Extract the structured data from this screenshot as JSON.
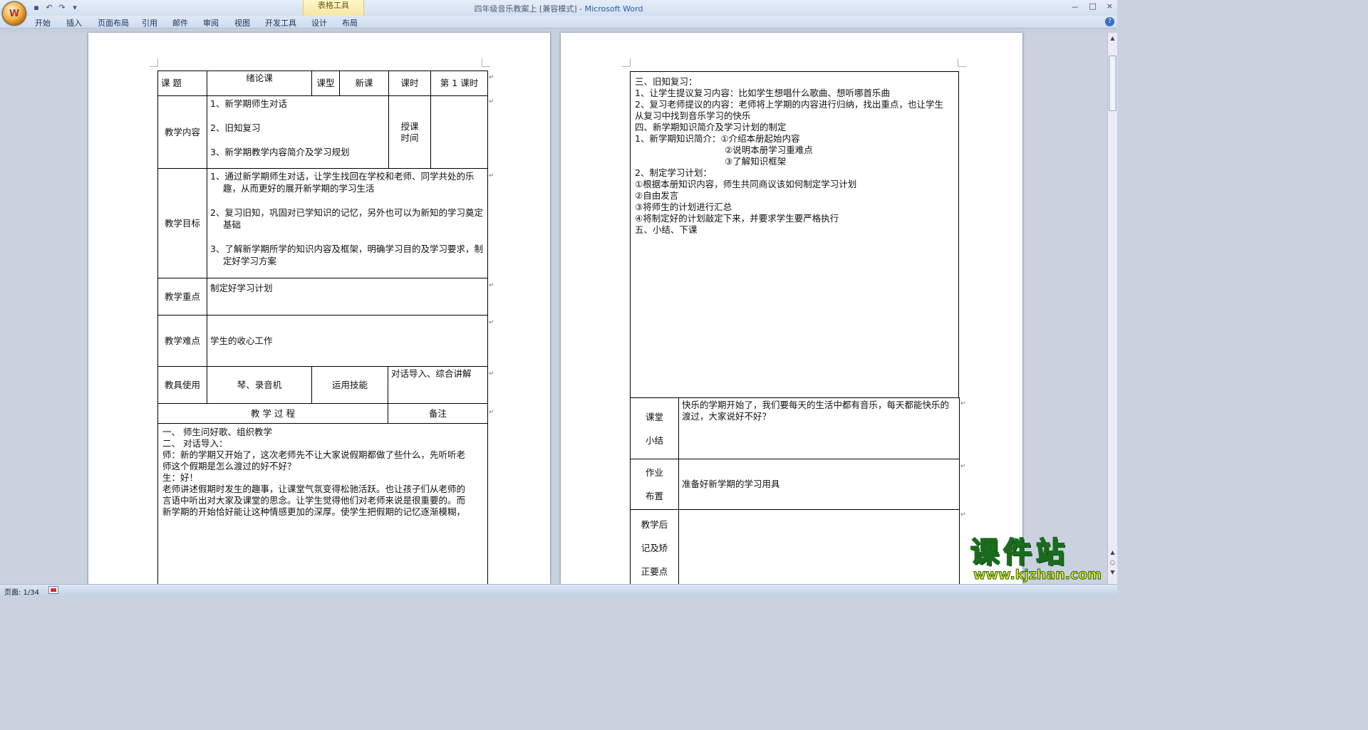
{
  "window": {
    "title_doc": "四年级音乐教案上 [兼容模式]",
    "title_sep": " - ",
    "title_app": "Microsoft Word",
    "context_tab_group": "表格工具",
    "controls": [
      "－",
      "□",
      "×"
    ]
  },
  "office_button": {
    "glyph": "W"
  },
  "qat": [
    "save-icon",
    "undo-icon",
    "redo-icon",
    "customize-icon"
  ],
  "qat_glyphs": [
    "▪",
    "↶",
    "↷",
    "▾"
  ],
  "ribbon_tabs": [
    "开始",
    "插入",
    "页面布局",
    "引用",
    "邮件",
    "审阅",
    "视图",
    "开发工具",
    "设计",
    "布局"
  ],
  "page1": {
    "row1": {
      "c1": "课    题",
      "c2": "绪论课",
      "c3": "课型",
      "c4": "新课",
      "c5": "课时",
      "c6": "第 1 课时"
    },
    "content": {
      "label": "教学内容",
      "items": [
        "1、新学期师生对话",
        "2、旧知复习",
        "3、新学期教学内容简介及学习规划"
      ],
      "time_label": "授课时间"
    },
    "goals": {
      "label": "教学目标",
      "items": [
        "1、通过新学期师生对话，让学生找回在学校和老师、同学共处的乐趣，从而更好的展开新学期的学习生活",
        "2、复习旧知，巩固对已学知识的记忆，另外也可以为新知的学习奠定基础",
        "3、了解新学期所学的知识内容及框架，明确学习目的及学习要求，制定好学习方案"
      ]
    },
    "key": {
      "label": "教学重点",
      "value": "制定好学习计划"
    },
    "difficulty": {
      "label": "教学难点",
      "value": "学生的收心工作"
    },
    "tools": {
      "label": "教具使用",
      "value": "琴、录音机",
      "skill_label": "运用技能",
      "skill_value": "对话导入、综合讲解"
    },
    "process": {
      "label": "教    学    过    程",
      "note": "备注"
    },
    "body": [
      "一、    师生问好歌、组织教学",
      "二、    对话导入：",
      "师：新的学期又开始了，这次老师先不让大家说假期都做了些什么，先听听老",
      "师这个假期是怎么渡过的好不好？",
      "生：好！",
      "老师讲述假期时发生的趣事，让课堂气氛变得松驰活跃。也让孩子们从老师的",
      "言语中听出对大家及课堂的思念。让学生觉得他们对老师来说是很重要的。而",
      "新学期的开始恰好能让这种情感更加的深厚。使学生把假期的记忆逐渐模糊，"
    ]
  },
  "page2": {
    "body": [
      "三、旧知复习：",
      "1、让学生提议复习内容：比如学生想唱什么歌曲、想听哪首乐曲",
      "2、复习老师提议的内容：老师将上学期的内容进行归纳，找出重点，也让学生",
      "从复习中找到音乐学习的快乐",
      "四、新学期知识简介及学习计划的制定",
      "1、新学期知识简介：①介绍本册起始内容",
      "②说明本册学习重难点",
      "③了解知识框架",
      "2、制定学习计划：",
      "①根据本册知识内容，师生共同商议该如何制定学习计划",
      "②自由发言",
      "③将师生的计划进行汇总",
      "④将制定好的计划敲定下来，并要求学生要严格执行",
      "五、小结、下课"
    ],
    "summary": {
      "label_a": "课堂",
      "label_b": "小结",
      "value": "快乐的学期开始了，我们要每天的生活中都有音乐，每天都能快乐的渡过，大家说好不好？"
    },
    "homework": {
      "label_a": "作业",
      "label_b": "布置",
      "value": "准备好新学期的学习用具"
    },
    "reflection": {
      "label_a": "教学后",
      "label_b": "记及矫",
      "label_c": "正要点"
    }
  },
  "status": {
    "page": "页面: 1/34"
  },
  "watermark": {
    "main": "课件站",
    "url": "www.kjzhan.com"
  },
  "marks": {
    "para": "↵",
    "cell": "↵"
  }
}
